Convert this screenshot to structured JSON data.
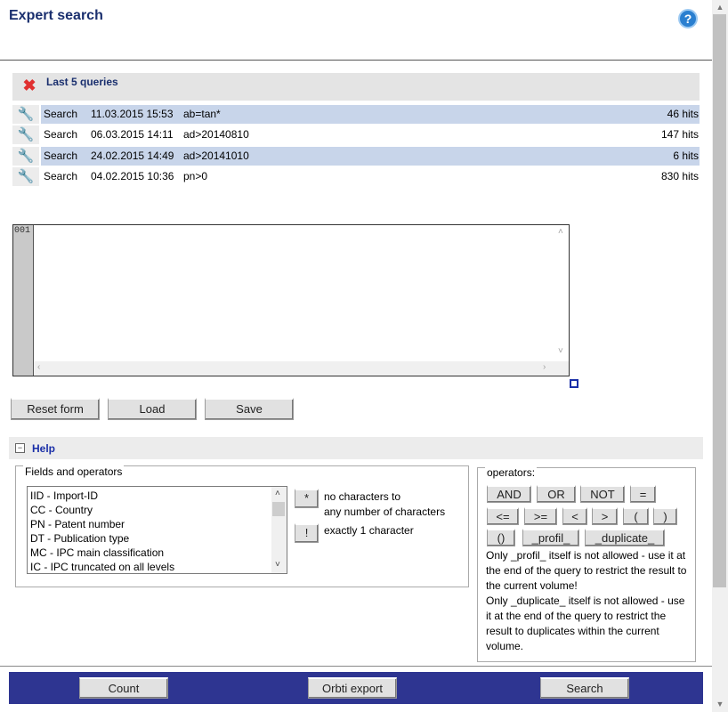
{
  "header": {
    "title": "Expert search",
    "help_icon": "question-icon",
    "help_glyph": "?"
  },
  "last_queries": {
    "title": "Last 5 queries",
    "clear_icon": "close-icon",
    "rows": [
      {
        "action": "Search",
        "date": "11.03.2015 15:53",
        "query": "ab=tan*",
        "hits": "46 hits",
        "highlighted": true
      },
      {
        "action": "Search",
        "date": "06.03.2015 14:11",
        "query": "ad>20140810",
        "hits": "147 hits",
        "highlighted": false
      },
      {
        "action": "Search",
        "date": "24.02.2015 14:49",
        "query": "ad>20141010",
        "hits": "6 hits",
        "highlighted": true
      },
      {
        "action": "Search",
        "date": "04.02.2015 10:36",
        "query": "pn>0",
        "hits": "830 hits",
        "highlighted": false
      }
    ]
  },
  "editor": {
    "line_number": "001",
    "value": ""
  },
  "form_buttons": {
    "reset": "Reset form",
    "load": "Load",
    "save": "Save"
  },
  "help": {
    "label": "Help",
    "toggle_glyph": "⊟",
    "fields_legend": "Fields and operators",
    "fields": [
      "IID - Import-ID",
      "CC - Country",
      "PN - Patent number",
      "DT - Publication type",
      "MC - IPC main classification",
      "IC - IPC truncated on all levels"
    ],
    "wildcards": {
      "star": "*",
      "star_desc_1": "no characters to",
      "star_desc_2": "any number of characters",
      "excl": "!",
      "excl_desc": "exactly 1 character"
    },
    "operators_legend": "operators:",
    "operators": {
      "and": "AND",
      "or": "OR",
      "not": "NOT",
      "eq": "=",
      "le": "<=",
      "ge": ">=",
      "lt": "<",
      "gt": ">",
      "lparen": "(",
      "rparen": ")",
      "parens": "()",
      "profil": "_profil_",
      "duplicate": "_duplicate_"
    },
    "note_1": "Only _profil_ itself is not allowed - use it at the end of the query to restrict the result to the current volume!",
    "note_2": "Only _duplicate_ itself is not allowed - use it at the end of the query to restrict the result to duplicates within the current volume."
  },
  "footer": {
    "count": "Count",
    "export": "Orbti export",
    "search": "Search"
  },
  "colors": {
    "footer_bg": "#2e3591",
    "row_highlight": "#c8d5ea",
    "title": "#1a2f6e"
  }
}
